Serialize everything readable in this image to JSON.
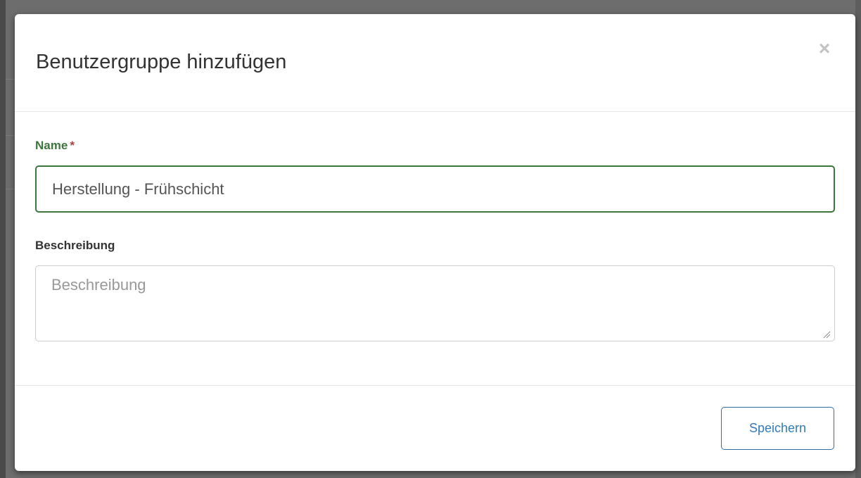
{
  "dialog": {
    "title": "Benutzergruppe hinzufügen",
    "close_symbol": "×"
  },
  "form": {
    "name": {
      "label": "Name",
      "required_marker": "*",
      "value": "Herstellung - Frühschicht"
    },
    "description": {
      "label": "Beschreibung",
      "value": "",
      "placeholder": "Beschreibung"
    }
  },
  "footer": {
    "save_label": "Speichern"
  },
  "colors": {
    "accent": "#337ab7",
    "success": "#3c763d",
    "required": "#a94442"
  },
  "icons": {
    "close": "close-icon",
    "resize": "resize-grip-icon"
  }
}
